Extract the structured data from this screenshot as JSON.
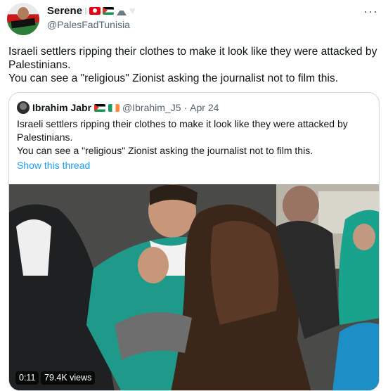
{
  "author": {
    "name": "Serene",
    "handle": "@PalesFadTunisia",
    "name_icons": [
      "tunisia-flag-icon",
      "palestine-flag-icon",
      "mountain-icon",
      "white-heart-icon"
    ]
  },
  "tweet": {
    "text_lines": [
      "Israeli settlers ripping their clothes to make it look like they were attacked by Palestinians.",
      "You can see a \"religious\" Zionist asking the journalist not to film this."
    ]
  },
  "quoted": {
    "name": "Ibrahim Jabr",
    "name_icons": [
      "palestine-flag-icon",
      "ireland-flag-icon"
    ],
    "handle": "@Ibrahim_J5",
    "separator": "·",
    "date": "Apr 24",
    "text_lines": [
      "Israeli settlers ripping their clothes to make it look like they were attacked by Palestinians.",
      "You can see a \"religious\" Zionist asking the journalist not to film this."
    ],
    "thread_link": "Show this thread",
    "video": {
      "duration": "0:11",
      "views": "79.4K views"
    }
  },
  "colors": {
    "text_primary": "#0f1419",
    "text_secondary": "#536471",
    "link": "#1d9bf0",
    "border": "#cfd9de"
  }
}
